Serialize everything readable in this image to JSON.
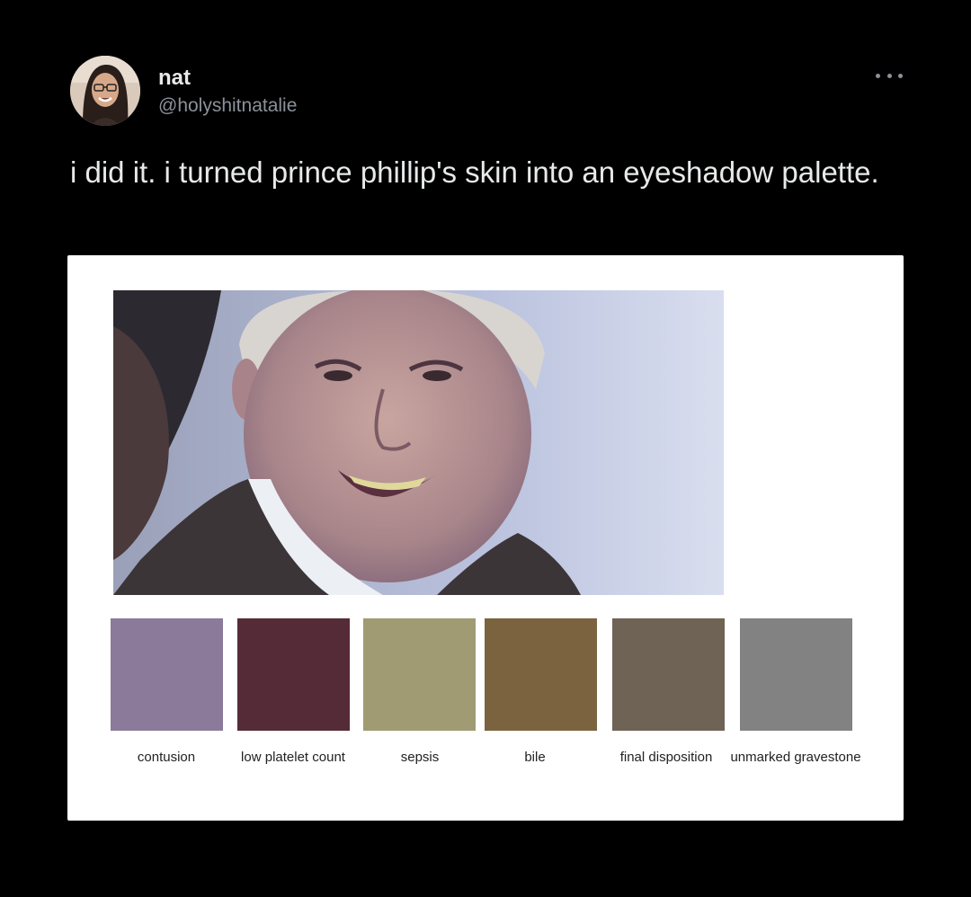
{
  "tweet": {
    "display_name": "nat",
    "handle": "@holyshitnatalie",
    "text": "i did it. i turned prince phillip's skin into an eyeshadow palette.",
    "more_icon": "more-horizontal-icon"
  },
  "palette": {
    "swatches": [
      {
        "label": "contusion",
        "color": "#8b7a99"
      },
      {
        "label": "low platelet count",
        "color": "#552b37"
      },
      {
        "label": "sepsis",
        "color": "#a09b72"
      },
      {
        "label": "bile",
        "color": "#7b6340"
      },
      {
        "label": "final disposition",
        "color": "#6e6355"
      },
      {
        "label": "unmarked gravestone",
        "color": "#828282"
      }
    ]
  }
}
